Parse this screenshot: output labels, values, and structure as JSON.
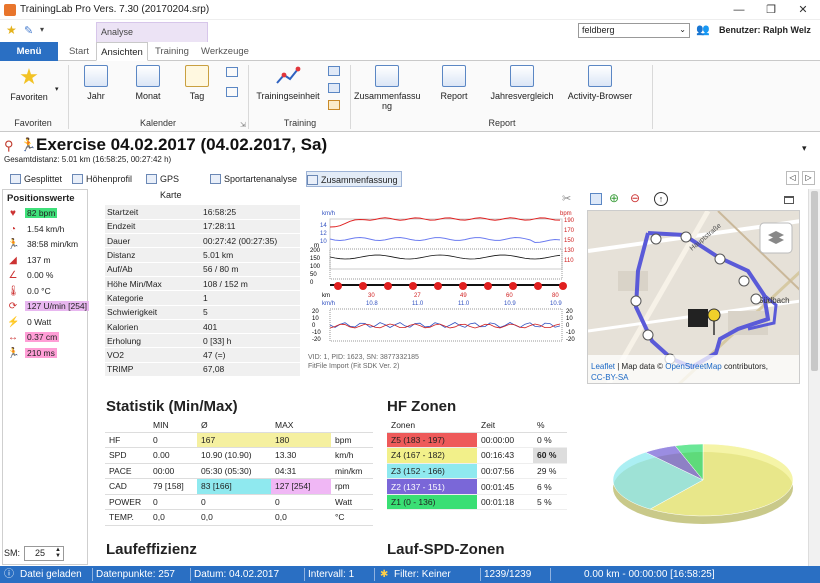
{
  "window": {
    "title": "TrainingLab Pro Vers. 7.30 (20170204.srp)",
    "minimize": "—",
    "restore": "❐",
    "close": "✕"
  },
  "ribbon_context": {
    "label": "Analyse"
  },
  "user": {
    "selected": "feldberg",
    "label": "Benutzer: Ralph Welz"
  },
  "tabs": {
    "menu": "Menü",
    "start": "Start",
    "ansichten": "Ansichten",
    "training": "Training",
    "werkzeuge": "Werkzeuge"
  },
  "ribbon": {
    "favoriten": "Favoriten",
    "jahr": "Jahr",
    "monat": "Monat",
    "tag": "Tag",
    "trainingseinheit": "Trainingseinheit",
    "zusammenfassung": "Zusammenfassu ng",
    "report": "Report",
    "jahresvergleich": "Jahresvergleich",
    "activity_browser": "Activity-Browser",
    "groups": {
      "favoriten": "Favoriten",
      "kalender": "Kalender",
      "training": "Training",
      "report": "Report"
    }
  },
  "exercise": {
    "title": "Exercise 04.02.2017 (04.02.2017, Sa)",
    "subtitle": "Gesamtdistanz: 5.01 km (16:58:25, 00:27:42 h)"
  },
  "subtabs": [
    "Gesplittet",
    "Höhenprofil",
    "GPS Karte",
    "Sportartenanalyse",
    "Zusammenfassung"
  ],
  "left_panel": {
    "title": "Positionswerte",
    "rows": [
      {
        "icon": "heart-icon",
        "value": "82 bpm",
        "bg": "#3fe07a"
      },
      {
        "icon": "speedometer-icon",
        "value": "1.54 km/h",
        "bg": ""
      },
      {
        "icon": "runner-icon",
        "value": "38:58 min/km",
        "bg": ""
      },
      {
        "icon": "elevation-icon",
        "value": "137 m",
        "bg": ""
      },
      {
        "icon": "slope-icon",
        "value": "0.00 %",
        "bg": ""
      },
      {
        "icon": "thermometer-icon",
        "value": "0.0 °C",
        "bg": ""
      },
      {
        "icon": "cadence-icon",
        "value": "127 U/min [254]",
        "bg": "#e8b7f0"
      },
      {
        "icon": "power-icon",
        "value": "0 Watt",
        "bg": ""
      },
      {
        "icon": "stride-icon",
        "value": "0.37 cm",
        "bg": "#ff9ed6"
      },
      {
        "icon": "runner-pink-icon",
        "value": "210 ms",
        "bg": "#ff9ed6"
      }
    ],
    "sm_label": "SM:",
    "sm_value": "25"
  },
  "summary": [
    [
      "Startzeit",
      "16:58:25"
    ],
    [
      "Endzeit",
      "17:28:11"
    ],
    [
      "Dauer",
      "00:27:42 (00:27:35)"
    ],
    [
      "Distanz",
      "5.01 km"
    ],
    [
      "Auf/Ab",
      "56 / 80 m"
    ],
    [
      "Höhe Min/Max",
      "108 / 152 m"
    ],
    [
      "Kategorie",
      "1"
    ],
    [
      "Schwierigkeit",
      "5"
    ],
    [
      "Kalorien",
      "401"
    ],
    [
      "Erholung",
      "0 [33] h"
    ],
    [
      "VO2",
      "47 (=)"
    ],
    [
      "TRIMP",
      "67,08"
    ]
  ],
  "chart_data": {
    "type": "line",
    "x": [
      0,
      10.8,
      11.0,
      11.0,
      10.9,
      10.9
    ],
    "x_ticks": [
      "30",
      "27",
      "49",
      "60",
      "80"
    ],
    "x_ticks2": [
      "10.8",
      "11.0",
      "11.0",
      "10.9",
      "10.9"
    ],
    "ylabel_left": "km/h",
    "ylabel_right": "bpm",
    "y_right_ticks": [
      "190",
      "170",
      "150",
      "130",
      "110"
    ],
    "y_left_ticks": [
      "14",
      "12",
      "10"
    ],
    "elev_ticks": [
      "200",
      "150",
      "100",
      "50",
      "0"
    ],
    "elev_label": "m",
    "xaxis_label": "km",
    "xaxis_label2": "km/h",
    "lower_ticks": [
      "20",
      "10",
      "0",
      "-10",
      "-20"
    ],
    "footer": "VID: 1, PID: 1623, SN: 3877332185\nFitFile Import (Fit SDK Ver. 2)"
  },
  "map": {
    "attribution_1": "Leaflet",
    "attribution_2": " | Map data © ",
    "attribution_3": "OpenStreetMap",
    "attribution_4": " contributors,",
    "attribution_5": "CC-BY-SA",
    "street": "Hauptstraße",
    "place": "Südbach"
  },
  "stats": {
    "title": "Statistik (Min/Max)",
    "headers": [
      "",
      "MIN",
      "Ø",
      "MAX",
      ""
    ],
    "rows": [
      [
        "HF",
        "0",
        "167",
        "180",
        "bpm"
      ],
      [
        "SPD",
        "0.00",
        "10.90  (10.90)",
        "13.30",
        "km/h"
      ],
      [
        "PACE",
        "00:00",
        "05:30  (05:30)",
        "04:31",
        "min/km"
      ],
      [
        "CAD",
        "79  [158]",
        "83  [166]",
        "127  [254]",
        "rpm"
      ],
      [
        "POWER",
        "0",
        "0",
        "0",
        "Watt"
      ],
      [
        "TEMP.",
        "0,0",
        "0,0",
        "0,0",
        "°C"
      ]
    ]
  },
  "hf_zones": {
    "title": "HF Zonen",
    "headers": [
      "Zonen",
      "Zeit",
      "%"
    ],
    "rows": [
      [
        "Z5 (183 - 197)",
        "00:00:00",
        "0 %",
        "#ee5a5a"
      ],
      [
        "Z4 (167 - 182)",
        "00:16:43",
        "60 %",
        "#f2f08a"
      ],
      [
        "Z3 (152 - 166)",
        "00:07:56",
        "29 %",
        "#8fe9ef"
      ],
      [
        "Z2 (137 - 151)",
        "00:01:45",
        "6 %",
        "#7a67d8"
      ],
      [
        "Z1 (0 - 136)",
        "00:01:18",
        "5 %",
        "#39df74"
      ]
    ]
  },
  "pie_values": [
    0,
    60,
    29,
    6,
    5
  ],
  "lauf_title_1": "Laufeffizienz",
  "lauf_title_2": "Lauf-SPD-Zonen",
  "status": {
    "s1": "Datei geladen",
    "s2": "Datenpunkte: 257",
    "s3": "Datum: 04.02.2017",
    "s4": "Intervall: 1",
    "s5": "Filter: Keiner",
    "s6": "1239/1239",
    "s7": "0.00 km - 00:00:00 [16:58:25]"
  }
}
